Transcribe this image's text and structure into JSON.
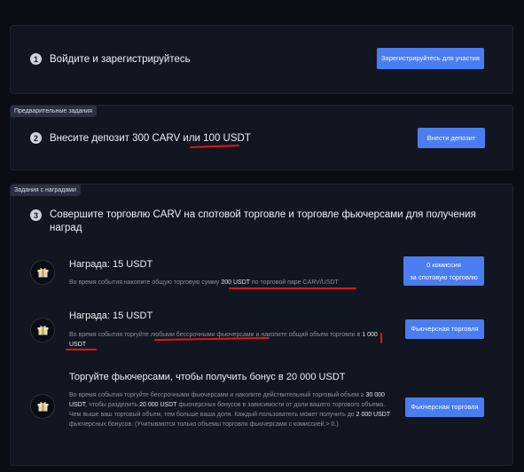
{
  "step1": {
    "number": "1",
    "title": "Войдите и зарегистрируйтесь",
    "button": "Зарегистрируйтесь для участия"
  },
  "step2": {
    "tag": "Предварительные задания",
    "number": "2",
    "title_prefix": "Внесите депозит 300 CARV или ",
    "title_highlight": "100 USDT",
    "button": "Внести депозит"
  },
  "step3": {
    "tag": "Задания с наградами",
    "number": "3",
    "title": "Совершите торговлю CARV на спотовой торговле и торговле фьючерсами для получения наград",
    "rewards": [
      {
        "icon": "gift-icon",
        "title": "Награда:  15 USDT",
        "desc_1": "Во время события накопите общую торговую сумму ",
        "desc_2": "200 USDT",
        "desc_3": " по торговой паре CARV/USDT",
        "button_line1": "0 комиссия",
        "button_line2": "за спотовую торговлю"
      },
      {
        "icon": "gift-icon",
        "title": "Награда:  15 USDT",
        "desc_1": "Во время события торгуйте любыми бессрочными фьючерсами и накопите общий объем торговли в ",
        "desc_2": "1 000 USDT",
        "button": "Фьючерсная торговля"
      },
      {
        "icon": "gift-icon",
        "title": "Торгуйте фьючерсами, чтобы получить бонус в  20 000 USDT",
        "desc_1": "Во время события торгуйте бессрочными фьючерсами и накопите действительный торговый объем ≥ ",
        "desc_2": "30 000 USDT",
        "desc_3": ", чтобы разделить ",
        "desc_4": "20 000 USDT",
        "desc_5": " фьючерсных бонусов в зависимости от доли вашего торгового объема. Чем выше ваш торговый объем, тем больше ваша доля. Каждый пользователь может получить до ",
        "desc_6": "2 000 USDT",
        "desc_7": " фьючерсных бонусов. (Учитываются только объемы торговли фьючерсами с комиссией.> 0.)",
        "button": "Фьючерсная торговля"
      }
    ]
  },
  "colors": {
    "accent": "#4a7ef0",
    "annotation": "#e0151a",
    "background": "#0a0d13",
    "card": "#121620"
  }
}
